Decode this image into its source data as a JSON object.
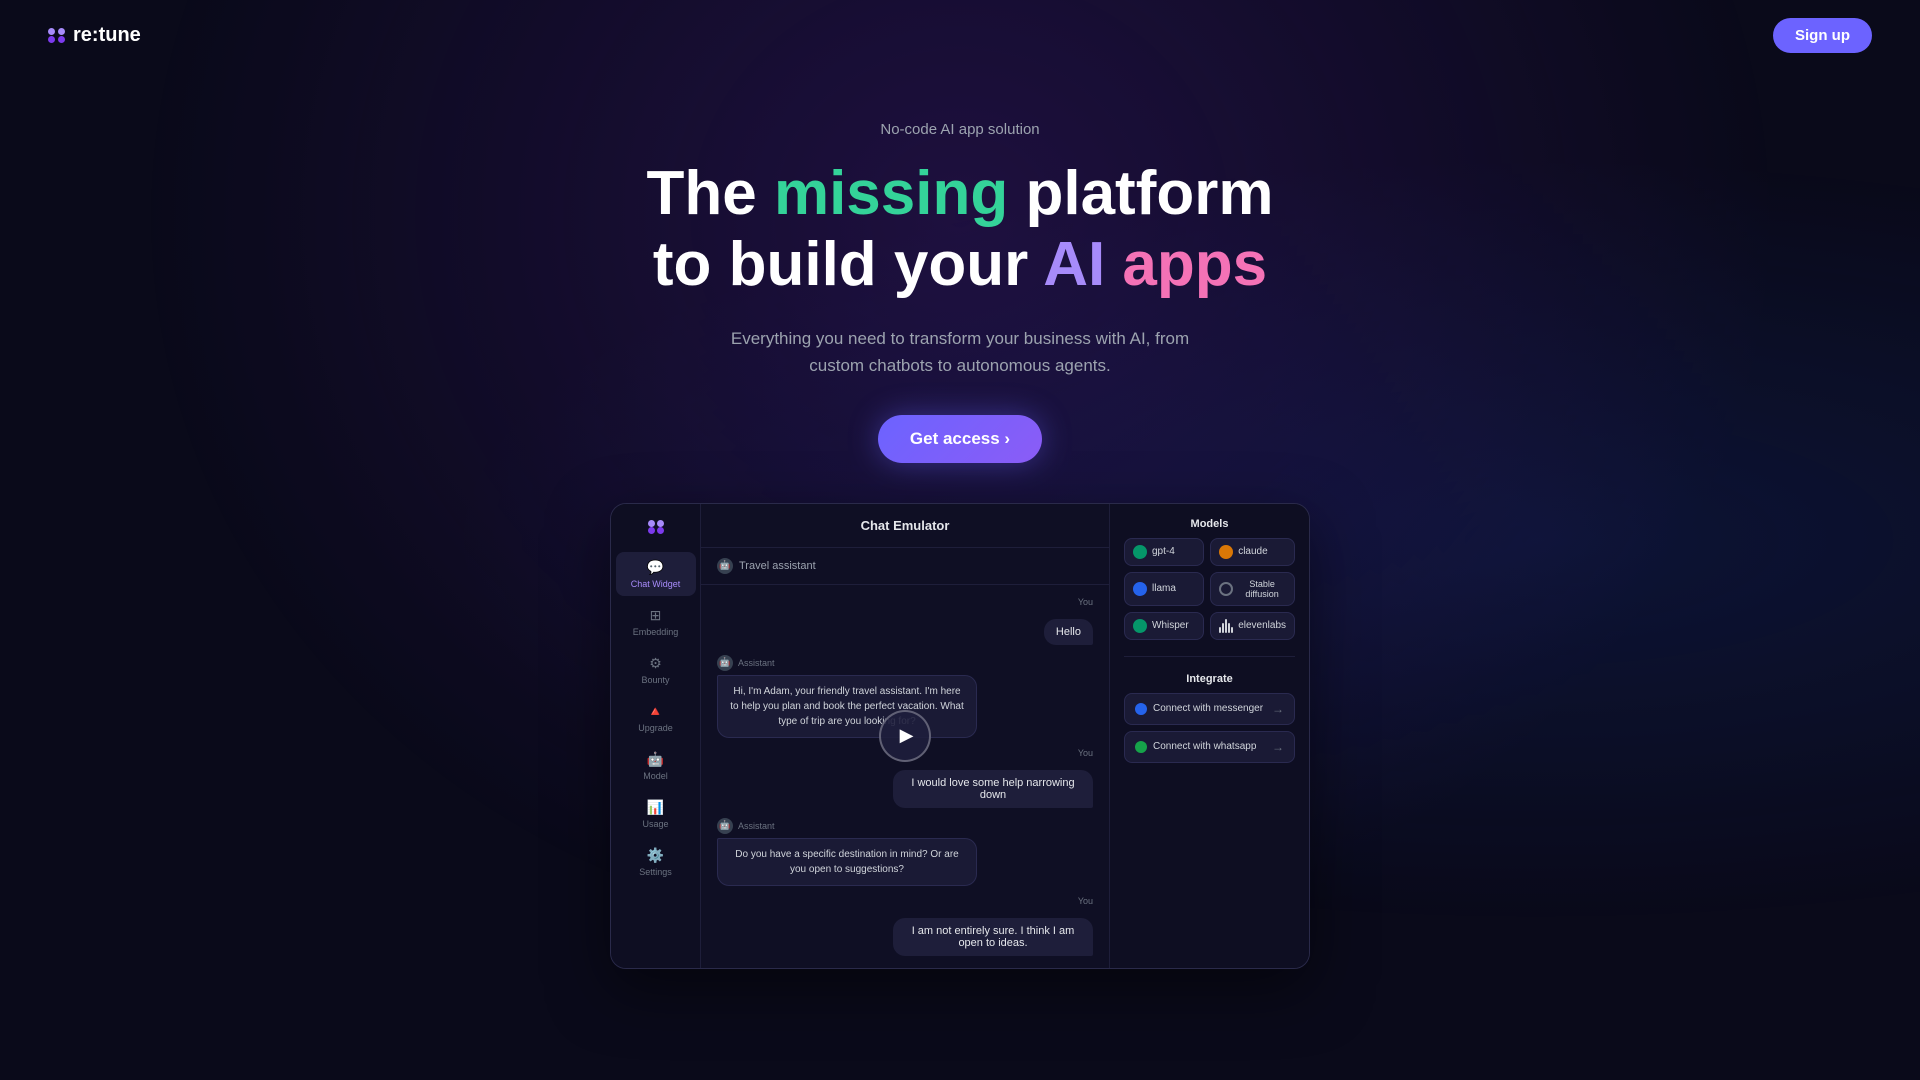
{
  "header": {
    "logo_text": "re:tune",
    "signup_label": "Sign up"
  },
  "hero": {
    "badge": "No-code AI app solution",
    "title_part1": "The ",
    "title_missing": "missing",
    "title_part2": " platform",
    "title_part3": "to build your ",
    "title_ai": "AI",
    "title_part4": " ",
    "title_apps": "apps",
    "subtitle": "Everything you need to transform your business with AI, from custom chatbots to autonomous agents.",
    "cta_label": "Get access ›"
  },
  "dashboard": {
    "header": "Chat Emulator",
    "subheader": "Travel assistant",
    "sidebar_items": [
      {
        "label": "Chat Widget",
        "active": true
      },
      {
        "label": "Embedding"
      },
      {
        "label": "Bounty"
      },
      {
        "label": "Upgrade"
      },
      {
        "label": "Model"
      },
      {
        "label": "Usage"
      },
      {
        "label": "Settings"
      }
    ],
    "messages": [
      {
        "type": "you",
        "text": "Hello"
      },
      {
        "type": "assistant",
        "text": "Hi, I'm Adam, your friendly travel assistant. I'm here to help you plan and book the perfect vacation. What type of trip are you looking for?"
      },
      {
        "type": "you",
        "text": "I would love some help narrowing down"
      },
      {
        "type": "assistant",
        "text": "Do you have a specific destination in mind? Or are you open to suggestions?"
      },
      {
        "type": "you",
        "text": "I am not entirely sure. I think I am open to ideas."
      }
    ],
    "models_section": {
      "title": "Models",
      "items": [
        {
          "label": "gpt-4",
          "color": "green"
        },
        {
          "label": "claude",
          "color": "orange"
        },
        {
          "label": "llama",
          "color": "blue"
        },
        {
          "label": "Stable diffusion",
          "color": "gray"
        },
        {
          "label": "Whisper",
          "color": "purple"
        },
        {
          "label": "elevenlabs",
          "color": "pink"
        }
      ]
    },
    "integrate_section": {
      "title": "Integrate",
      "items": [
        {
          "label": "Connect with messenger",
          "color": "messenger"
        },
        {
          "label": "Connect with whatsapp",
          "color": "whatsapp"
        }
      ]
    }
  }
}
